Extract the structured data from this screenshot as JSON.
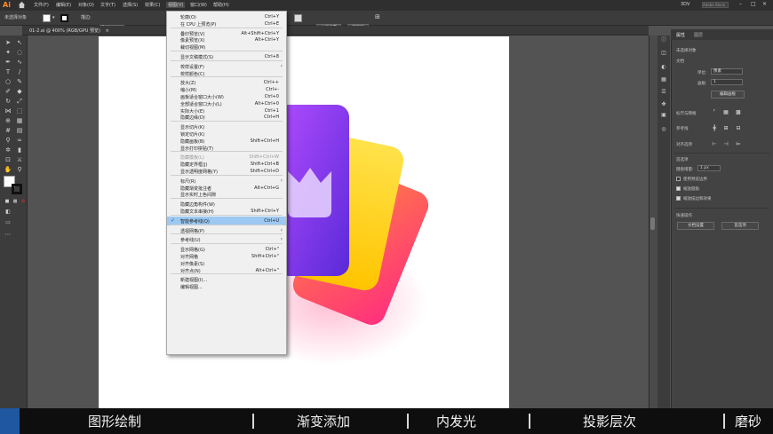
{
  "app": {
    "logo": "Ai",
    "home_icon": "home-icon"
  },
  "menubar": {
    "items": [
      "文件(F)",
      "编辑(E)",
      "对象(O)",
      "文字(T)",
      "选择(S)",
      "效果(C)",
      "视图(V)",
      "窗口(W)",
      "帮助(H)"
    ],
    "right": [
      "3DV",
      "Adobe Stock"
    ]
  },
  "control_bar": {
    "selection_label": "未选择对象",
    "stroke_label": "描边:",
    "stroke_value": "1 pt",
    "doc_setup_button": "文档设置",
    "prefs_button": "首选项"
  },
  "document_tab": {
    "title": "01-2.ai @ 400% (RGB/GPU 预览)",
    "close": "×"
  },
  "view_menu": {
    "items": [
      {
        "label": "轮廓(O)",
        "shortcut": "Ctrl+Y"
      },
      {
        "label": "在 CPU 上预览(P)",
        "shortcut": "Ctrl+E"
      },
      {
        "sep": true
      },
      {
        "label": "叠印预览(V)",
        "shortcut": "Alt+Shift+Ctrl+Y"
      },
      {
        "label": "像素预览(X)",
        "shortcut": "Alt+Ctrl+Y"
      },
      {
        "label": "裁切视图(M)",
        "shortcut": ""
      },
      {
        "sep": true
      },
      {
        "label": "显示文稿模式(S)",
        "shortcut": "Ctrl+8"
      },
      {
        "sep": true
      },
      {
        "label": "校样设置(F)",
        "shortcut": "",
        "submenu": true
      },
      {
        "label": "校样颜色(C)",
        "shortcut": ""
      },
      {
        "sep": true
      },
      {
        "label": "放大(Z)",
        "shortcut": "Ctrl++"
      },
      {
        "label": "缩小(M)",
        "shortcut": "Ctrl+-"
      },
      {
        "label": "画板适合窗口大小(W)",
        "shortcut": "Ctrl+0"
      },
      {
        "label": "全部适合窗口大小(L)",
        "shortcut": "Alt+Ctrl+0"
      },
      {
        "label": "实际大小(E)",
        "shortcut": "Ctrl+1"
      },
      {
        "label": "隐藏边缘(D)",
        "shortcut": "Ctrl+H"
      },
      {
        "sep": true
      },
      {
        "label": "显示切片(K)",
        "shortcut": ""
      },
      {
        "label": "锁定切片(K)",
        "shortcut": ""
      },
      {
        "label": "隐藏画板(B)",
        "shortcut": "Shift+Ctrl+H"
      },
      {
        "label": "显示打印拼贴(T)",
        "shortcut": ""
      },
      {
        "sep": true
      },
      {
        "label": "隐藏模板(L)",
        "shortcut": "Shift+Ctrl+W",
        "disabled": true
      },
      {
        "label": "隐藏定界框(J)",
        "shortcut": "Shift+Ctrl+B"
      },
      {
        "label": "显示透明度网格(Y)",
        "shortcut": "Shift+Ctrl+D"
      },
      {
        "sep": true
      },
      {
        "label": "标尺(R)",
        "shortcut": "",
        "submenu": true
      },
      {
        "label": "隐藏渐变批注者",
        "shortcut": "Alt+Ctrl+G"
      },
      {
        "label": "显示实时上色间隙",
        "shortcut": ""
      },
      {
        "sep": true
      },
      {
        "label": "隐藏边角构件(W)",
        "shortcut": ""
      },
      {
        "label": "隐藏文本串接(H)",
        "shortcut": "Shift+Ctrl+Y"
      },
      {
        "sep": true
      },
      {
        "label": "智能参考线(Q)",
        "shortcut": "Ctrl+U",
        "checked": true,
        "highlighted": true
      },
      {
        "sep": true
      },
      {
        "label": "透视网格(P)",
        "shortcut": "",
        "submenu": true
      },
      {
        "sep": true
      },
      {
        "label": "参考线(U)",
        "shortcut": "",
        "submenu": true
      },
      {
        "sep": true
      },
      {
        "label": "显示网格(G)",
        "shortcut": "Ctrl+\""
      },
      {
        "label": "对齐网格",
        "shortcut": "Shift+Ctrl+\""
      },
      {
        "label": "对齐像素(S)",
        "shortcut": ""
      },
      {
        "label": "对齐点(N)",
        "shortcut": "Alt+Ctrl+\""
      },
      {
        "sep": true
      },
      {
        "label": "新建视图(I)...",
        "shortcut": ""
      },
      {
        "label": "编辑视图...",
        "shortcut": ""
      }
    ]
  },
  "properties_panel": {
    "tabs": [
      "属性",
      "图层"
    ],
    "no_selection": "未选择对象",
    "doc_section": "文档",
    "unit_label": "单位:",
    "unit_value": "像素",
    "artboard_label": "画板:",
    "artboard_value": "1",
    "edit_artboard_button": "编辑画板",
    "ruler_grid_label": "标尺与网格",
    "guides_label": "参考线",
    "align_label": "对齐选项",
    "prefs_section": "首选项",
    "keyboard_increment_label": "键盘增量:",
    "keyboard_increment_value": "1 px",
    "checkboxes": [
      {
        "label": "使用预览边界",
        "checked": false
      },
      {
        "label": "缩放圆角",
        "checked": true
      },
      {
        "label": "缩放描边和效果",
        "checked": true
      }
    ],
    "quick_actions_label": "快速操作",
    "doc_setup_button": "文档设置",
    "prefs_button": "首选项"
  },
  "subtitle": {
    "items": [
      "图形绘制",
      "渐变添加",
      "内发光",
      "投影层次",
      "磨砂"
    ]
  },
  "colors": {
    "menu_highlight": "#9cc8f2",
    "card_purple": "#7a2fe0",
    "card_yellow": "#ffd21a",
    "card_pink": "#ff3d7a",
    "accent_orange": "#ff8a2a"
  }
}
